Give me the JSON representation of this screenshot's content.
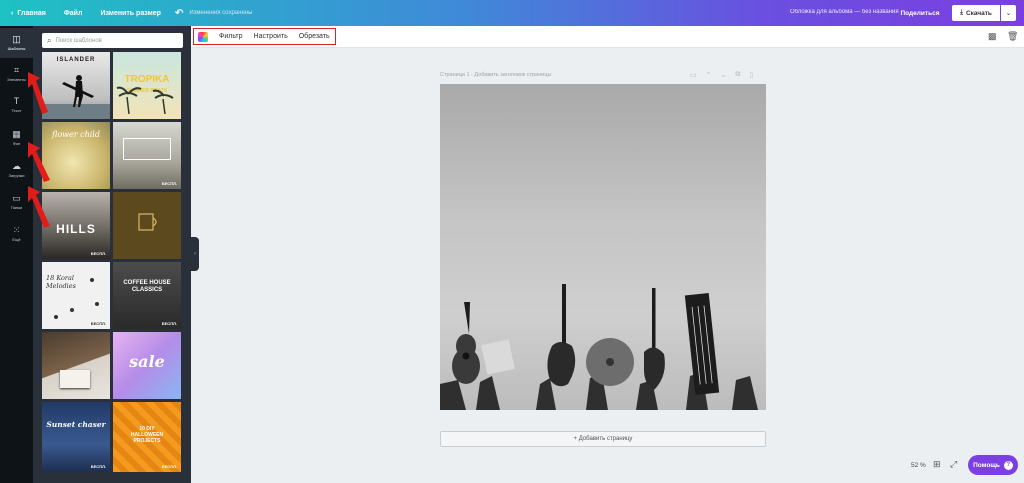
{
  "topbar": {
    "home": "Главная",
    "file": "Файл",
    "resize": "Изменить размер",
    "saved_status": "Изменения сохранены",
    "doc_title": "Обложка для альбома — без названия",
    "share": "Поделиться",
    "download": "Скачать"
  },
  "rail": [
    {
      "label": "Шаблоны",
      "icon": "templates-icon"
    },
    {
      "label": "Элементы",
      "icon": "elements-icon"
    },
    {
      "label": "Текст",
      "icon": "text-icon"
    },
    {
      "label": "Фон",
      "icon": "background-icon"
    },
    {
      "label": "Загрузки",
      "icon": "upload-icon"
    },
    {
      "label": "Папки",
      "icon": "folder-icon"
    },
    {
      "label": "Ещё",
      "icon": "more-icon"
    }
  ],
  "panel": {
    "search_placeholder": "Поиск шаблонов",
    "templates": [
      {
        "title": "ISLANDER",
        "badge": ""
      },
      {
        "title": "TROPIKA",
        "subtitle": "SUMMER BEATS",
        "badge": ""
      },
      {
        "title": "flower child",
        "badge": ""
      },
      {
        "title": "",
        "badge": "БЕСПЛ."
      },
      {
        "title": "HILLS",
        "badge": "БЕСПЛ."
      },
      {
        "title": "",
        "badge": ""
      },
      {
        "title": "18 Koral Melodies",
        "badge": "БЕСПЛ."
      },
      {
        "title": "COFFEE HOUSE CLASSICS",
        "badge": "БЕСПЛ."
      },
      {
        "title": "",
        "badge": ""
      },
      {
        "title": "sale",
        "badge": ""
      },
      {
        "title": "Sunset chaser",
        "badge": "БЕСПЛ."
      },
      {
        "title": "10 DIY HALLOWEEN PROJECTS",
        "badge": "БЕСПЛ."
      }
    ]
  },
  "toolbar": {
    "filter": "Фильтр",
    "adjust": "Настроить",
    "crop": "Обрезать"
  },
  "canvas": {
    "page_label": "Страница 1 - Добавить заголовок страницы",
    "add_page": "+ Добавить страницу"
  },
  "footer": {
    "zoom": "52 %",
    "help": "Помощь",
    "help_q": "?"
  },
  "colors": {
    "accent": "#7c3fe4",
    "highlight_box": "#d6222b",
    "rail_bg": "#0e1318",
    "panel_bg": "#293039"
  }
}
